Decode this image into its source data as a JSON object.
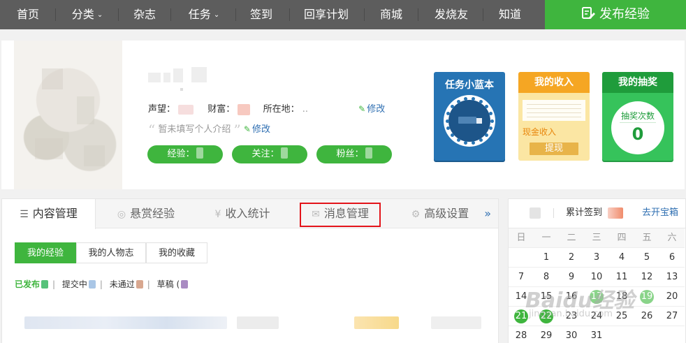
{
  "nav": {
    "items": [
      {
        "label": "首页",
        "caret": false
      },
      {
        "label": "分类",
        "caret": true
      },
      {
        "label": "杂志",
        "caret": false
      },
      {
        "label": "任务",
        "caret": true
      },
      {
        "label": "签到",
        "caret": false
      },
      {
        "label": "回享计划",
        "caret": false
      },
      {
        "label": "商城",
        "caret": false
      },
      {
        "label": "发烧友",
        "caret": false
      },
      {
        "label": "知道",
        "caret": false
      }
    ],
    "caret_glyph": "⌄",
    "publish_label": "发布经验"
  },
  "profile": {
    "reputation_label": "声望：",
    "wealth_label": "财富：",
    "location_label": "所在地：",
    "location_value": "..",
    "edit_label": "修改",
    "intro_text": "暂未填写个人介绍",
    "intro_edit_label": "修改",
    "pills": [
      {
        "label": "经验："
      },
      {
        "label": "关注："
      },
      {
        "label": "粉丝："
      }
    ]
  },
  "widgets": {
    "task_book": {
      "title": "任务小蓝本"
    },
    "income": {
      "title": "我的收入",
      "cash_label": "现金收入",
      "withdraw_label": "提现"
    },
    "lottery": {
      "title": "我的抽奖",
      "count_label": "抽奖次数",
      "count": "0"
    }
  },
  "tabs": {
    "items": [
      {
        "label": "内容管理",
        "icon": "list-icon",
        "glyph": "☰",
        "active": true
      },
      {
        "label": "悬赏经验",
        "icon": "reward-icon",
        "glyph": "◎",
        "active": false
      },
      {
        "label": "收入统计",
        "icon": "yen-icon",
        "glyph": "¥",
        "active": false
      },
      {
        "label": "消息管理",
        "icon": "mail-icon",
        "glyph": "✉",
        "active": false
      },
      {
        "label": "高级设置",
        "icon": "gear-icon",
        "glyph": "⚙",
        "active": false
      }
    ],
    "more_glyph": "»"
  },
  "subtabs": [
    {
      "label": "我的经验",
      "active": true
    },
    {
      "label": "我的人物志",
      "active": false
    },
    {
      "label": "我的收藏",
      "active": false
    }
  ],
  "filters": {
    "published": "已发布",
    "submitted": "提交中",
    "rejected": "未通过",
    "draft": "草稿 (",
    "separator": "|"
  },
  "calendar": {
    "checkin_label": "累计签到",
    "treasure_link": "去开宝箱",
    "weekdays": [
      "日",
      "一",
      "二",
      "三",
      "四",
      "五",
      "六"
    ],
    "weeks": [
      [
        "",
        "1",
        "2",
        "3",
        "4",
        "5",
        "6"
      ],
      [
        "7",
        "8",
        "9",
        "10",
        "11",
        "12",
        "13"
      ],
      [
        "14",
        "15",
        "16",
        "17",
        "18",
        "19",
        "20"
      ],
      [
        "21",
        "22",
        "23",
        "24",
        "25",
        "26",
        "27"
      ],
      [
        "28",
        "29",
        "30",
        "31",
        "",
        "",
        ""
      ]
    ],
    "checked_days": [
      "17",
      "19",
      "21",
      "22"
    ]
  },
  "watermark": {
    "main": "Baidu经验",
    "sub": "jingyan.baidu.com"
  },
  "colors": {
    "nav_bg": "#5d5d5d",
    "brand_green": "#3fb53e",
    "link_blue": "#2f6fb2",
    "highlight_red": "#e3141a"
  }
}
